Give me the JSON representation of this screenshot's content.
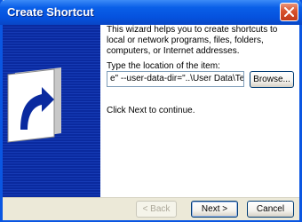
{
  "window": {
    "title": "Create Shortcut",
    "close_icon": "close-icon"
  },
  "wizard": {
    "intro_text": "This wizard helps you to create shortcuts to local or network programs, files, folders, computers, or Internet addresses.",
    "location_label": "Type the location of the item:",
    "location_value": "e\" --user-data-dir=\"..\\User Data\\Test\"",
    "browse_label": "Browse...",
    "continue_text": "Click Next to continue.",
    "banner_icon": "shortcut-arrow-icon"
  },
  "footer": {
    "back_label": "< Back",
    "next_label": "Next >",
    "cancel_label": "Cancel"
  },
  "colors": {
    "titlebar": "#0A5FE8",
    "banner": "#0A2A9F",
    "dialog_face": "#ECE9D8"
  }
}
